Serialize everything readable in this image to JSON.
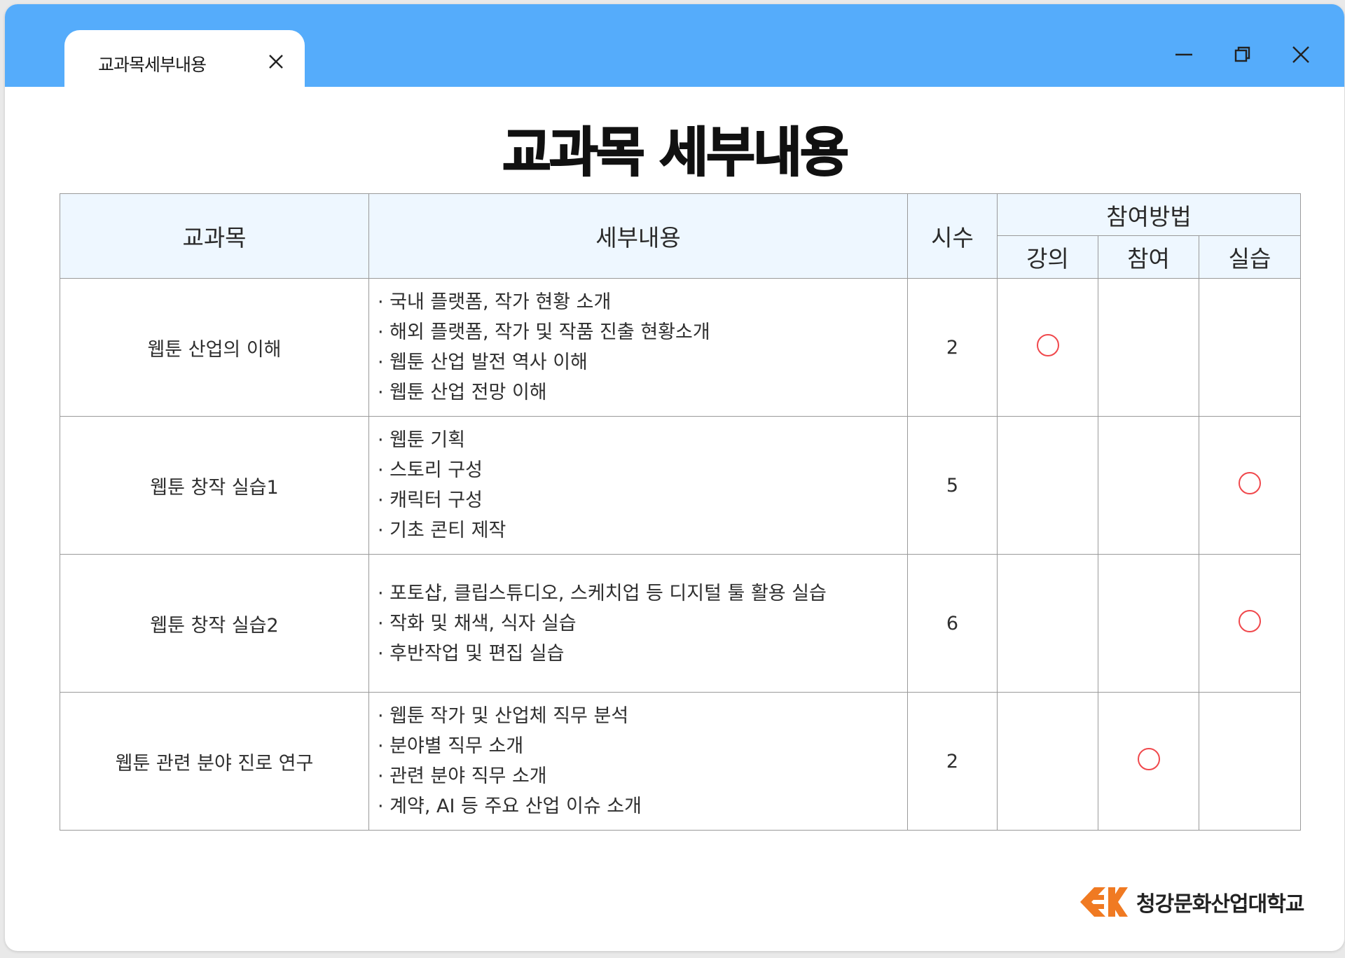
{
  "tab": {
    "title": "교과목세부내용"
  },
  "page_title": "교과목 세부내용",
  "table": {
    "headers": {
      "subject": "교과목",
      "detail": "세부내용",
      "hours": "시수",
      "method": "참여방법",
      "lecture": "강의",
      "participation": "참여",
      "practice": "실습"
    },
    "rows": [
      {
        "subject": "웹툰 산업의 이해",
        "details": [
          "· 국내 플랫폼, 작가 현황 소개",
          "· 해외 플랫폼, 작가 및 작품 진출 현황소개",
          "· 웹툰 산업 발전 역사 이해",
          "· 웹툰 산업 전망 이해"
        ],
        "hours": "2",
        "method": "lecture"
      },
      {
        "subject": "웹툰 창작 실습1",
        "details": [
          "· 웹툰 기획",
          "· 스토리 구성",
          "· 캐릭터 구성",
          "· 기초 콘티 제작"
        ],
        "hours": "5",
        "method": "practice"
      },
      {
        "subject": "웹툰 창작 실습2",
        "details": [
          "· 포토샵, 클립스튜디오, 스케치업 등 디지털 툴 활용 실습",
          "· 작화 및 채색, 식자 실습",
          "· 후반작업 및 편집 실습"
        ],
        "hours": "6",
        "method": "practice"
      },
      {
        "subject": "웹툰 관련 분야 진로 연구",
        "details": [
          "· 웹툰 작가 및 산업체 직무 분석",
          "· 분야별 직무 소개",
          "· 관련 분야 직무 소개",
          "· 계약, AI 등 주요 산업 이슈 소개"
        ],
        "hours": "2",
        "method": "participation"
      }
    ]
  },
  "logo": {
    "text": "청강문화산업대학교"
  },
  "colors": {
    "titlebar": "#55acfb",
    "header_bg": "#eef7ff",
    "mark": "#f0484c",
    "logo_accent": "#f07a22"
  },
  "icons": {
    "tab_close": "close-icon",
    "minimize": "minimize-icon",
    "maximize": "restore-icon",
    "close": "close-icon",
    "mark": "circle-mark-icon"
  }
}
